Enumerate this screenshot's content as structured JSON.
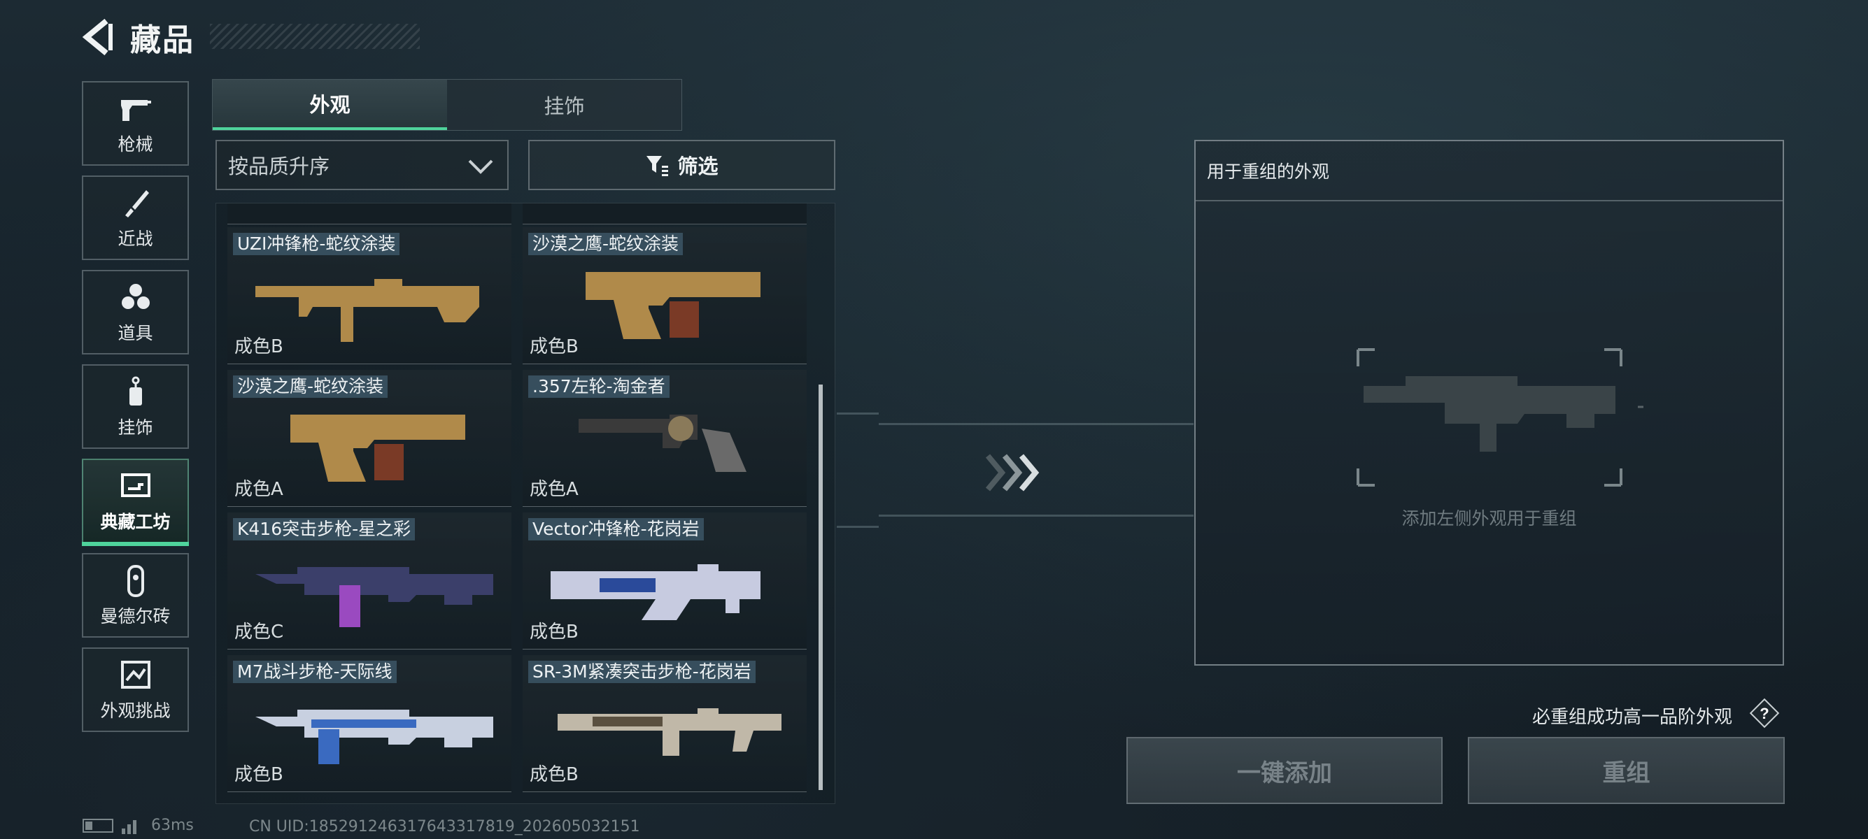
{
  "header": {
    "title": "藏品"
  },
  "categories": [
    {
      "label": "枪械",
      "icon": "pistol-icon"
    },
    {
      "label": "近战",
      "icon": "knife-icon"
    },
    {
      "label": "道具",
      "icon": "grenade-cluster-icon"
    },
    {
      "label": "挂饰",
      "icon": "charm-icon"
    },
    {
      "label": "典藏工坊",
      "icon": "workshop-icon",
      "active": true
    },
    {
      "label": "曼德尔砖",
      "icon": "brick-icon"
    },
    {
      "label": "外观挑战",
      "icon": "challenge-icon"
    }
  ],
  "tabs": [
    {
      "label": "外观",
      "active": true
    },
    {
      "label": "挂饰",
      "active": false
    }
  ],
  "sort": {
    "label": "按品质升序"
  },
  "filter": {
    "label": "筛选"
  },
  "items": [
    {
      "name": "UZI冲锋枪-蛇纹涂装",
      "grade": "成色B",
      "icon": "smg-icon",
      "color": "#b08a4a"
    },
    {
      "name": "沙漠之鹰-蛇纹涂装",
      "grade": "成色B",
      "icon": "pistol-icon",
      "color": "#b08a4a"
    },
    {
      "name": "沙漠之鹰-蛇纹涂装",
      "grade": "成色A",
      "icon": "pistol-icon",
      "color": "#b08a4a"
    },
    {
      "name": ".357左轮-淘金者",
      "grade": "成色A",
      "icon": "revolver-icon",
      "color": "#6a6a6a"
    },
    {
      "name": "K416突击步枪-星之彩",
      "grade": "成色C",
      "icon": "rifle-icon",
      "color": "#7a4aa0"
    },
    {
      "name": "Vector冲锋枪-花岗岩",
      "grade": "成色B",
      "icon": "smg-icon",
      "color": "#c7cbe0"
    },
    {
      "name": "M7战斗步枪-天际线",
      "grade": "成色B",
      "icon": "rifle-icon",
      "color": "#3a6ac0"
    },
    {
      "name": "SR-3M紧凑突击步枪-花岗岩",
      "grade": "成色B",
      "icon": "rifle-icon",
      "color": "#c0b8a8"
    }
  ],
  "panel": {
    "title": "用于重组的外观",
    "hint": "添加左侧外观用于重组"
  },
  "note": "必重组成功高一品阶外观",
  "buttons": {
    "add_all": "一键添加",
    "recompose": "重组"
  },
  "footer": {
    "ping": "63ms",
    "uid": "CN UID:185291246317643317819_202605032151"
  },
  "colors": {
    "accent": "#4fd39c"
  }
}
